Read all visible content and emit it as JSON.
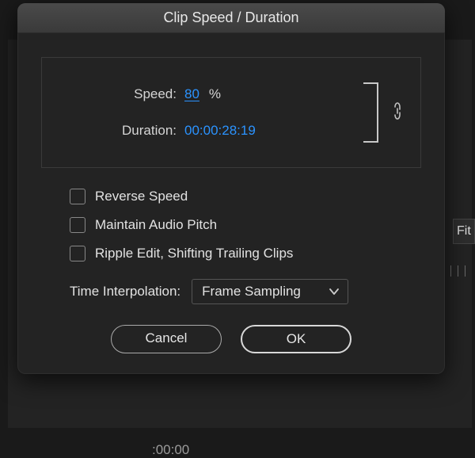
{
  "dialog": {
    "title": "Clip Speed / Duration",
    "speed_label": "Speed:",
    "speed_value": "80",
    "speed_pct": "%",
    "duration_label": "Duration:",
    "duration_value": "00:00:28:19",
    "checks": [
      {
        "label": "Reverse Speed",
        "checked": false
      },
      {
        "label": "Maintain Audio Pitch",
        "checked": false
      },
      {
        "label": "Ripple Edit, Shifting Trailing Clips",
        "checked": false
      }
    ],
    "interp_label": "Time Interpolation:",
    "interp_value": "Frame Sampling",
    "cancel": "Cancel",
    "ok": "OK"
  },
  "background": {
    "fit_label": "Fit",
    "timecode": ":00:00"
  }
}
